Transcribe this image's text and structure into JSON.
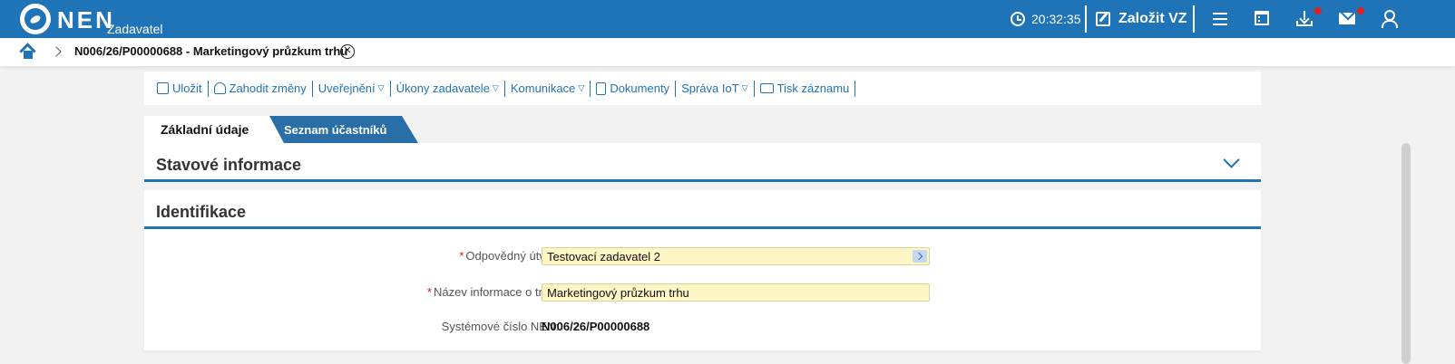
{
  "header": {
    "brand": "NEN",
    "role": "Zadavatel",
    "time": "20:32:35",
    "create_label": "Založit VZ",
    "accent": "#1f73b7",
    "icons": [
      "clock-icon",
      "edit-icon",
      "menu-icon",
      "calendar-icon",
      "download-icon",
      "mail-icon",
      "user-icon"
    ]
  },
  "breadcrumb": {
    "current": "N006/26/P00000688 - Marketingový průzkum trhu",
    "close_glyph": "✕"
  },
  "toolbar": {
    "items": [
      {
        "label": "Uložit",
        "icon": "save-icon"
      },
      {
        "label": "Zahodit změny",
        "icon": "undo-icon"
      },
      {
        "label": "Uveřejnění",
        "caret": "▽"
      },
      {
        "label": "Úkony zadavatele",
        "caret": "▽"
      },
      {
        "label": "Komunikace",
        "caret": "▽"
      },
      {
        "label": "Dokumenty",
        "icon": "clipboard-icon"
      },
      {
        "label": "Správa IoT",
        "caret": "▽"
      },
      {
        "label": "Tisk záznamu",
        "icon": "print-icon"
      }
    ]
  },
  "tabs": [
    {
      "label": "Základní údaje",
      "active": true
    },
    {
      "label": "Seznam účastníků",
      "active": false
    }
  ],
  "sections": {
    "status": {
      "title": "Stavové informace"
    },
    "identification": {
      "title": "Identifikace",
      "fields": [
        {
          "label": "Odpovědný útvar:",
          "required": true,
          "value": "Testovací zadavatel 2"
        },
        {
          "label": "Název informace o trhu:",
          "required": true,
          "value": "Marketingový průzkum trhu"
        },
        {
          "label": "Systémové číslo NEN:",
          "required": false,
          "value": "N006/26/P00000688"
        }
      ]
    }
  },
  "required_mark": "*"
}
